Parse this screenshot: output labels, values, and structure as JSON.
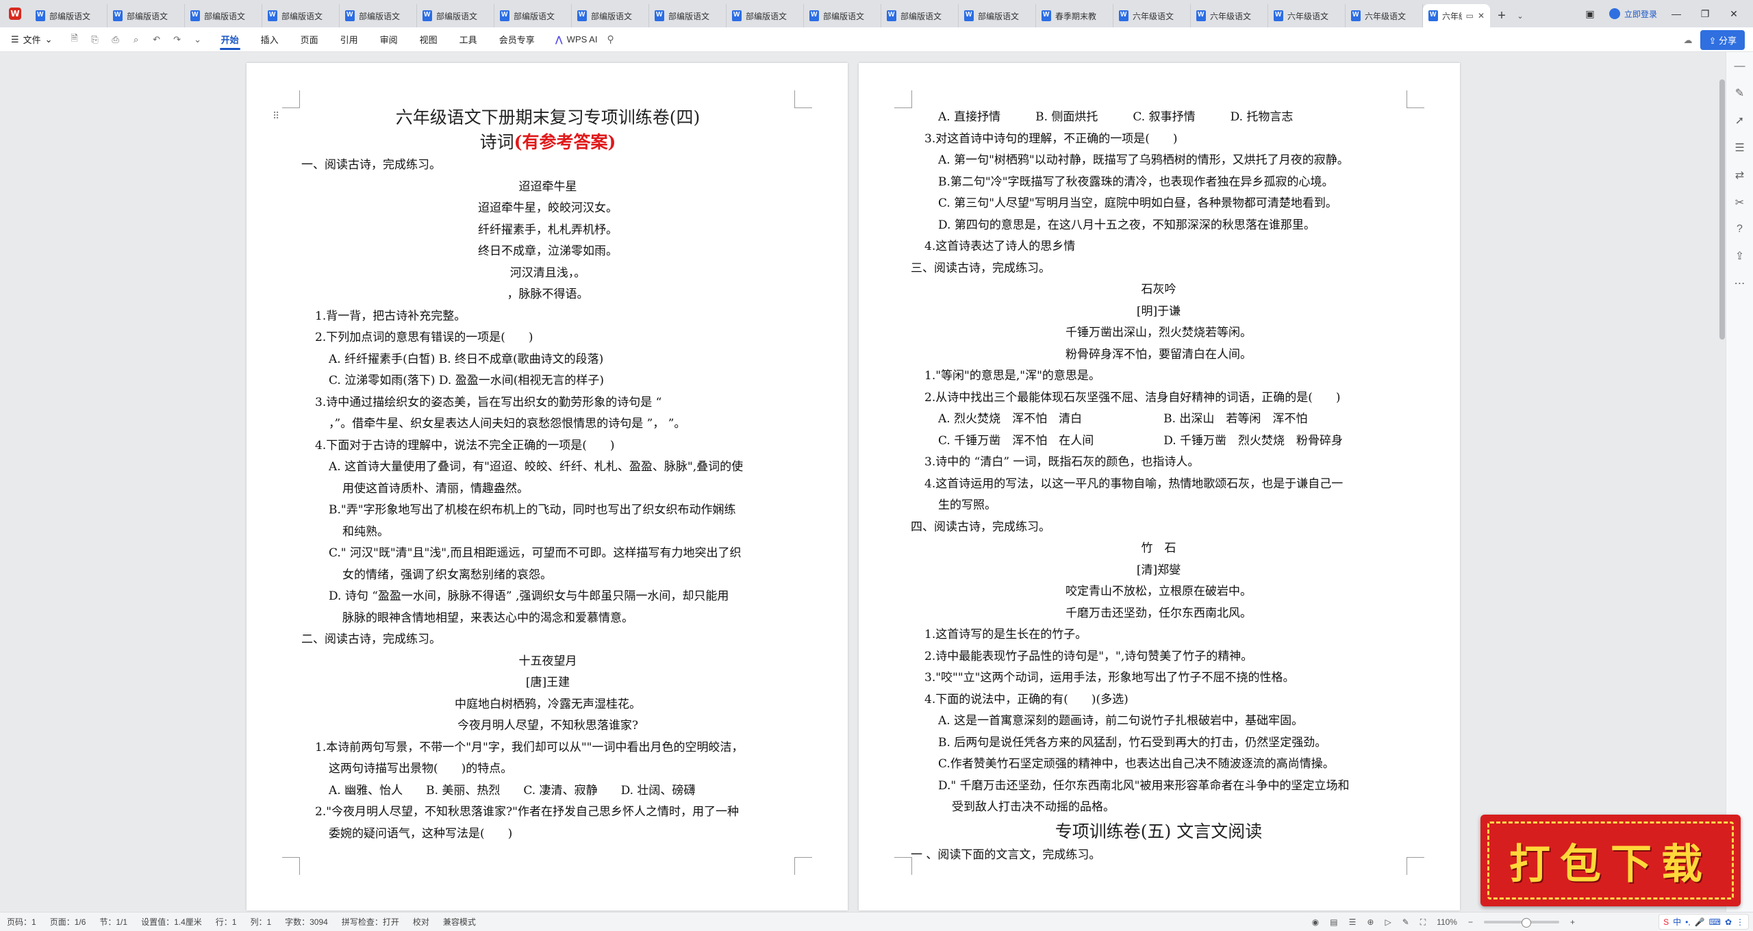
{
  "tabbar": {
    "tabs": [
      {
        "label": "部编版语文"
      },
      {
        "label": "部编版语文"
      },
      {
        "label": "部编版语文"
      },
      {
        "label": "部编版语文"
      },
      {
        "label": "部编版语文"
      },
      {
        "label": "部编版语文"
      },
      {
        "label": "部编版语文"
      },
      {
        "label": "部编版语文"
      },
      {
        "label": "部编版语文"
      },
      {
        "label": "部编版语文"
      },
      {
        "label": "部编版语文"
      },
      {
        "label": "部编版语文"
      },
      {
        "label": "部编版语文"
      },
      {
        "label": "春季期末教"
      },
      {
        "label": "六年级语文"
      },
      {
        "label": "六年级语文"
      },
      {
        "label": "六年级语文"
      },
      {
        "label": "六年级语文"
      }
    ],
    "active_tab": {
      "label": "六年级"
    },
    "add_tab": "+",
    "login_label": "立即登录"
  },
  "menubar": {
    "file_label": "文件",
    "items": [
      {
        "label": "开始",
        "active": true
      },
      {
        "label": "插入"
      },
      {
        "label": "页面"
      },
      {
        "label": "引用"
      },
      {
        "label": "审阅"
      },
      {
        "label": "视图"
      },
      {
        "label": "工具"
      },
      {
        "label": "会员专享"
      }
    ],
    "wps_ai_label": "WPS AI",
    "share_label": "分享"
  },
  "page1": {
    "title_line1": "六年级语文下册期末复习专项训练卷(四)",
    "title_line2_black": "诗词",
    "title_line2_red": "(有参考答案)",
    "lines": [
      {
        "t": "一、阅读古诗，完成练习。",
        "s": "i0"
      },
      {
        "t": "迢迢牵牛星",
        "s": "c"
      },
      {
        "t": "迢迢牵牛星，皎皎河汉女。",
        "s": "c"
      },
      {
        "t": "纤纤擢素手，札札弄机杼。",
        "s": "c"
      },
      {
        "t": "终日不成章，泣涕零如雨。",
        "s": "c"
      },
      {
        "t": "河汉清且浅，。",
        "s": "c"
      },
      {
        "t": "，脉脉不得语。",
        "s": "c"
      },
      {
        "t": "1.背一背，把古诗补充完整。",
        "s": "i1"
      },
      {
        "t": "2.下列加点词的意思有错误的一项是(　　)",
        "s": "i1"
      },
      {
        "t": "A. 纤纤擢素手(白皙) B. 终日不成章(歌曲诗文的段落)",
        "s": "i2"
      },
      {
        "t": "C. 泣涕零如雨(落下) D. 盈盈一水间(相视无言的样子)",
        "s": "i2"
      },
      {
        "t": "3.诗中通过描绘织女的姿态美，旨在写出织女的勤劳形象的诗句是 “",
        "s": "i1"
      },
      {
        "t": "，”。借牵牛星、织女星表达人间夫妇的哀愁怨恨情思的诗句是 ”， ”。",
        "s": "i2"
      },
      {
        "t": "4.下面对于古诗的理解中，说法不完全正确的一项是(　　)",
        "s": "i1"
      },
      {
        "t": "A. 这首诗大量使用了叠词，有\"迢迢、皎皎、纤纤、札札、盈盈、脉脉\",叠词的使",
        "s": "i2"
      },
      {
        "t": "用使这首诗质朴、清丽，情趣盎然。",
        "s": "i3"
      },
      {
        "t": "B.\"弄\"字形象地写出了机梭在织布机上的飞动，同时也写出了织女织布动作娴练",
        "s": "i2"
      },
      {
        "t": "和纯熟。",
        "s": "i3"
      },
      {
        "t": "C.\" 河汉\"既\"清\"且\"浅\",而且相距遥远，可望而不可即。这样描写有力地突出了织",
        "s": "i2"
      },
      {
        "t": "女的情绪，强调了织女离愁别绪的哀怨。",
        "s": "i3"
      },
      {
        "t": "D. 诗句 “盈盈一水间，脉脉不得语” ,强调织女与牛郎虽只隔一水间，却只能用",
        "s": "i2"
      },
      {
        "t": "脉脉的眼神含情地相望，来表达心中的渴念和爱慕情意。",
        "s": "i3"
      },
      {
        "t": "二、阅读古诗，完成练习。",
        "s": "i0"
      },
      {
        "t": "十五夜望月",
        "s": "c"
      },
      {
        "t": "[唐]王建",
        "s": "c"
      },
      {
        "t": "中庭地白树栖鸦，冷露无声湿桂花。",
        "s": "c"
      },
      {
        "t": "今夜月明人尽望，不知秋思落谁家?",
        "s": "c"
      },
      {
        "t": "1.本诗前两句写景，不带一个\"月\"字，我们却可以从\"\"一词中看出月色的空明皎洁，",
        "s": "i1"
      },
      {
        "t": "这两句诗描写出景物(　　)的特点。",
        "s": "i2"
      },
      {
        "t": "A. 幽雅、怡人　　B. 美丽、热烈　　C. 凄清、寂静　　D. 壮阔、磅礴",
        "s": "i2"
      },
      {
        "t": "2.\"今夜月明人尽望，不知秋思落谁家?\"作者在抒发自己思乡怀人之情时，用了一种",
        "s": "i1"
      },
      {
        "t": "委婉的疑问语气，这种写法是(　　)",
        "s": "i2"
      }
    ]
  },
  "page2": {
    "lines_top": [
      {
        "t": "A. 直接抒情　　　B. 侧面烘托　　　C. 叙事抒情　　　D. 托物言志",
        "s": "i2"
      },
      {
        "t": "3.对这首诗中诗句的理解，不正确的一项是(　　)",
        "s": "i1"
      },
      {
        "t": "A. 第一句\"树栖鸦\"以动衬静，既描写了乌鸦栖树的情形，又烘托了月夜的寂静。",
        "s": "i2"
      },
      {
        "t": "B.第二句\"冷\"字既描写了秋夜露珠的清冷，也表现作者独在异乡孤寂的心境。",
        "s": "i2"
      },
      {
        "t": "C. 第三句\"人尽望\"写明月当空，庭院中明如白昼，各种景物都可清楚地看到。",
        "s": "i2"
      },
      {
        "t": "D. 第四句的意思是，在这八月十五之夜，不知那深深的秋思落在谁那里。",
        "s": "i2"
      },
      {
        "t": "4.这首诗表达了诗人的思乡情",
        "s": "i1"
      },
      {
        "t": "三、阅读古诗，完成练习。",
        "s": "i0"
      },
      {
        "t": "石灰吟",
        "s": "c"
      },
      {
        "t": "[明]于谦",
        "s": "c"
      },
      {
        "t": "千锤万凿出深山，烈火焚烧若等闲。",
        "s": "c"
      },
      {
        "t": "粉骨碎身浑不怕，要留清白在人间。",
        "s": "c"
      },
      {
        "t": "1.\"等闲\"的意思是,\"浑\"的意思是。",
        "s": "i1"
      },
      {
        "t": "2.从诗中找出三个最能体现石灰坚强不屈、洁身自好精神的词语，正确的是(　　)",
        "s": "i1"
      },
      {
        "t": "A. 烈火焚烧　浑不怕　清白　　　　　　　B. 出深山　若等闲　浑不怕",
        "s": "i2"
      },
      {
        "t": "C. 千锤万凿　浑不怕　在人间　　　　　　D. 千锤万凿　烈火焚烧　粉骨碎身",
        "s": "i2"
      },
      {
        "t": "3.诗中的 “清白” 一词，既指石灰的颜色，也指诗人。",
        "s": "i1"
      },
      {
        "t": "4.这首诗运用的写法，以这一平凡的事物自喻，热情地歌颂石灰，也是于谦自己一",
        "s": "i1"
      },
      {
        "t": "生的写照。",
        "s": "i2"
      },
      {
        "t": "四、阅读古诗，完成练习。",
        "s": "i0"
      },
      {
        "t": "竹　石",
        "s": "c"
      },
      {
        "t": "[清]郑燮",
        "s": "c"
      },
      {
        "t": "咬定青山不放松，立根原在破岩中。",
        "s": "c"
      },
      {
        "t": "千磨万击还坚劲，任尔东西南北风。",
        "s": "c"
      },
      {
        "t": "1.这首诗写的是生长在的竹子。",
        "s": "i1"
      },
      {
        "t": "2.诗中最能表现竹子品性的诗句是\"，\",诗句赞美了竹子的精神。",
        "s": "i1"
      },
      {
        "t": "3.\"咬\"\"立\"这两个动词，运用手法，形象地写出了竹子不屈不挠的性格。",
        "s": "i1"
      },
      {
        "t": "4.下面的说法中，正确的有(　　)(多选)",
        "s": "i1"
      },
      {
        "t": "A. 这是一首寓意深刻的题画诗，前二句说竹子扎根破岩中，基础牢固。",
        "s": "i2"
      },
      {
        "t": "B. 后两句是说任凭各方来的风猛刮，竹石受到再大的打击，仍然坚定强劲。",
        "s": "i2"
      },
      {
        "t": "C.作者赞美竹石坚定顽强的精神中，也表达出自己决不随波逐流的高尚情操。",
        "s": "i2"
      },
      {
        "t": "D.\" 千磨万击还坚劲，任尔东西南北风\"被用来形容革命者在斗争中的坚定立场和",
        "s": "i2"
      },
      {
        "t": "受到敌人打击决不动摇的品格。",
        "s": "i3"
      }
    ],
    "section_title": "专项训练卷(五)  文言文阅读",
    "lines_bottom": [
      {
        "t": "一 、阅读下面的文言文，完成练习。",
        "s": "i0"
      }
    ]
  },
  "statusbar": {
    "page_num": "页码：1",
    "page_count": "页面：1/6",
    "section": "节：1/1",
    "setting": "设置值：1.4厘米",
    "row": "行：1",
    "col": "列：1",
    "word_count": "字数：3094",
    "spellcheck": "拼写检查：打开",
    "proofread": "校对",
    "compat": "兼容模式",
    "zoom": "110%"
  },
  "download_badge": "打包下载",
  "colors": {
    "accent": "#1a56c6",
    "answer_red": "#e0191b",
    "badge_red": "#d71e1e",
    "badge_gold": "#ffd83a"
  }
}
